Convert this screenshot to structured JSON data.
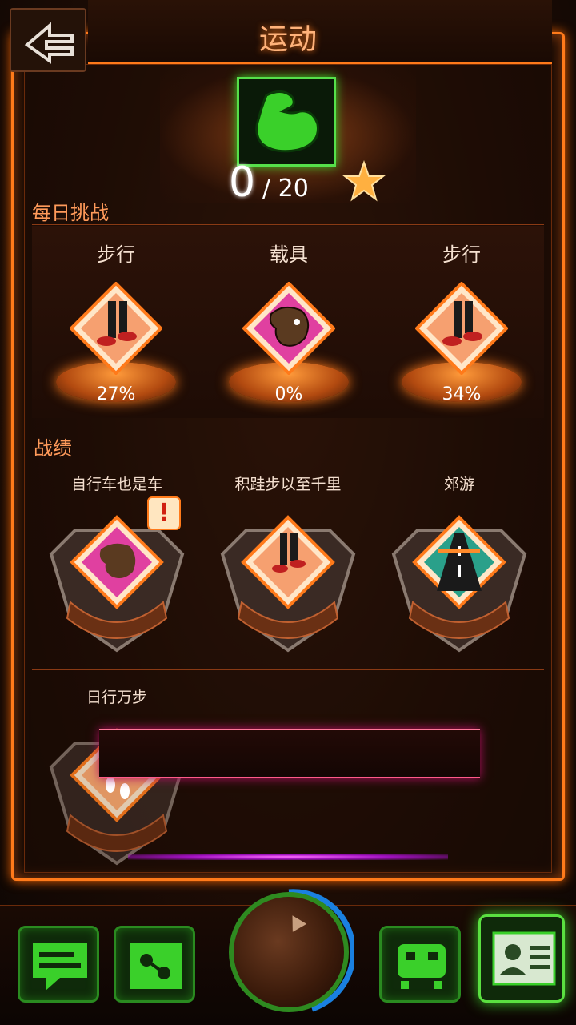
{
  "header": {
    "title": "运动",
    "back_icon": "back-arrow-icon"
  },
  "hero": {
    "icon": "muscle-arm-icon",
    "score": "0",
    "total": "/ 20",
    "star_icon": "star-icon"
  },
  "daily_challenge": {
    "section_title": "每日挑战",
    "items": [
      {
        "label": "步行",
        "icon": "walking-legs-icon",
        "progress": "27%"
      },
      {
        "label": "载具",
        "icon": "horse-head-icon",
        "progress": "0%"
      },
      {
        "label": "步行",
        "icon": "walking-legs-icon",
        "progress": "34%"
      }
    ]
  },
  "records": {
    "section_title": "战绩",
    "items": [
      {
        "label": "自行车也是车",
        "icon": "horse-head-icon",
        "alert": "!"
      },
      {
        "label": "积跬步以至千里",
        "icon": "walking-legs-icon"
      },
      {
        "label": "郊游",
        "icon": "road-icon"
      }
    ],
    "extra": {
      "label": "日行万步",
      "icon": "footprints-icon"
    }
  },
  "bottom_nav": [
    {
      "name": "chat-icon"
    },
    {
      "name": "share-icon"
    },
    {
      "name": "radar-icon"
    },
    {
      "name": "robot-icon"
    },
    {
      "name": "profile-card-icon"
    }
  ],
  "colors": {
    "accent": "#ff7a1a",
    "green": "#3ad02a",
    "text": "#f5e0d0",
    "section": "#ff9a5a"
  }
}
